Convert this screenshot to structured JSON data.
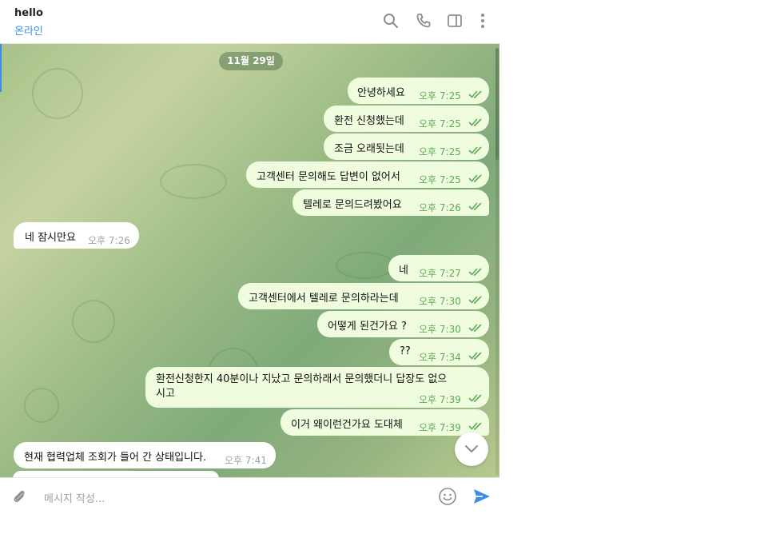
{
  "header": {
    "title": "hello",
    "status": "온라인",
    "icons": [
      "search-icon",
      "phone-icon",
      "sidebar-toggle-icon",
      "more-vertical-icon"
    ]
  },
  "chat": {
    "date": "11월 29일",
    "messages": [
      {
        "dir": "out",
        "text": "안녕하세요",
        "time": "오후 7:25"
      },
      {
        "dir": "out",
        "text": "환전 신청했는데",
        "time": "오후 7:25"
      },
      {
        "dir": "out",
        "text": "조금 오래됫는데",
        "time": "오후 7:25"
      },
      {
        "dir": "out",
        "text": "고객센터 문의해도 답변이 없어서",
        "time": "오후 7:25"
      },
      {
        "dir": "out",
        "text": "텔레로 문의드려봤어요",
        "time": "오후 7:26"
      },
      {
        "dir": "in",
        "text": "네 잠시만요",
        "time": "오후 7:26"
      },
      {
        "dir": "out",
        "text": "네",
        "time": "오후 7:27"
      },
      {
        "dir": "out",
        "text": "고객센터에서 텔레로 문의하라는데",
        "time": "오후 7:30"
      },
      {
        "dir": "out",
        "text": "어떻게 된건가요 ?",
        "time": "오후 7:30"
      },
      {
        "dir": "out",
        "text": "??",
        "time": "오후 7:34"
      },
      {
        "dir": "out",
        "text": "환전신청한지 40분이나 지났고 문의하래서 문의했더니 답장도 없으시고",
        "time": "오후 7:39"
      },
      {
        "dir": "out",
        "text": "이거 왜이런건가요 도대체",
        "time": "오후 7:39"
      },
      {
        "dir": "in",
        "text": "현재 협력업체 조회가 들어 간 상태입니다.",
        "time": "오후 7:41"
      }
    ]
  },
  "composer": {
    "placeholder": "메시지 작성...",
    "icons": [
      "attach-icon",
      "emoji-icon",
      "send-icon"
    ]
  },
  "colors": {
    "accent": "#3a8ee6",
    "outgoing": "#effdde",
    "incoming": "#ffffff",
    "time_out": "#5faa5a"
  }
}
